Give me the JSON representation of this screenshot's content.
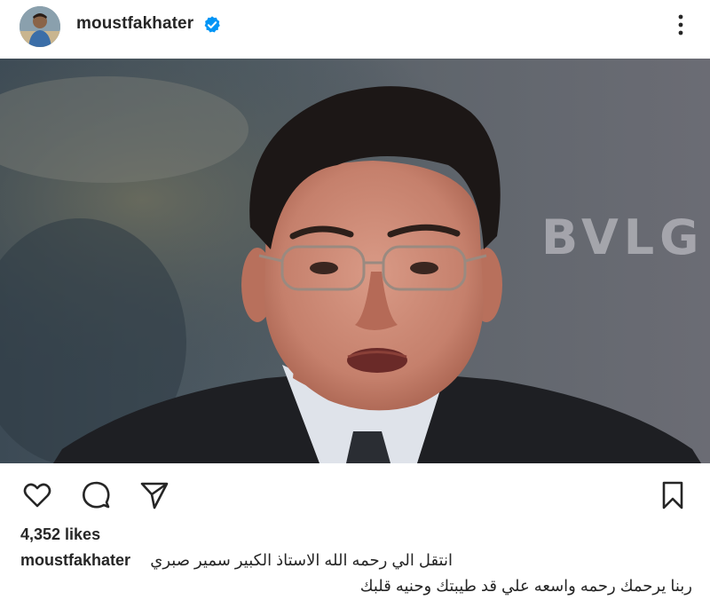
{
  "post": {
    "username": "moustfakhater",
    "verified_icon": "verified-badge-icon",
    "more_icon": "three-dots-vertical-icon",
    "photo_watermark": "BVLG",
    "likes": "4,352 likes",
    "caption_user": "moustfakhater",
    "caption_line1": "انتقل الي رحمه الله الاستاذ الكبير سمير صبري",
    "caption_line2": "ربنا يرحمك رحمه واسعه علي قد طيبتك وحنيه قلبك",
    "accent_color": "#0095f6"
  },
  "actions": {
    "like_icon": "heart-icon",
    "comment_icon": "comment-icon",
    "share_icon": "send-icon",
    "save_icon": "bookmark-icon"
  }
}
